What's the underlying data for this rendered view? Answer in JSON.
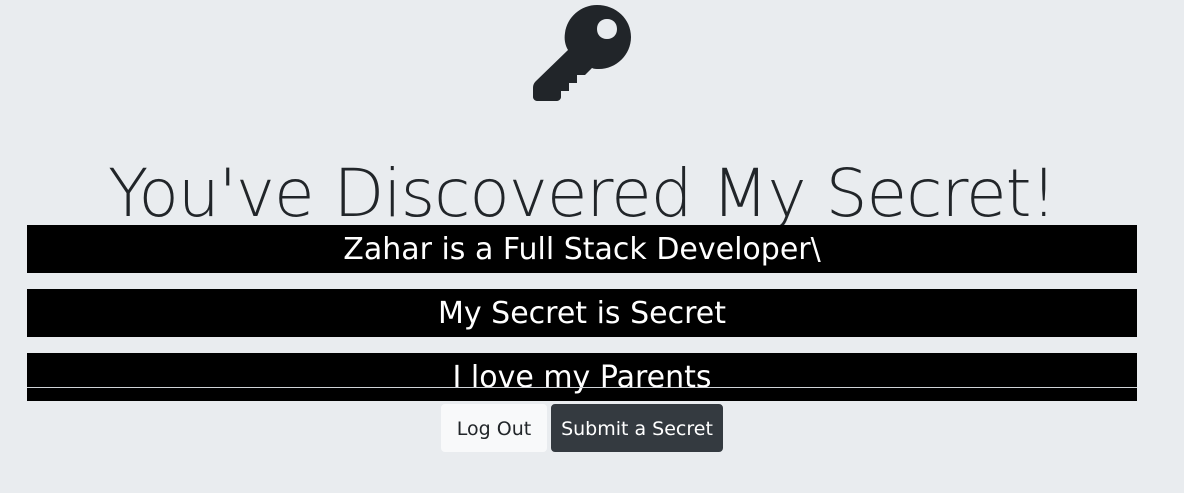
{
  "page": {
    "icon": "key-icon",
    "title": "You've Discovered My Secret!",
    "background_color": "#e9ecef"
  },
  "secrets": [
    {
      "text": "Zahar is a Full Stack Developer\\"
    },
    {
      "text": "My Secret is Secret"
    },
    {
      "text": "I love my Parents"
    }
  ],
  "actions": {
    "logout_label": "Log Out",
    "submit_label": "Submit a Secret",
    "submit_color": "#343a40",
    "logout_color": "#f8f9fa"
  }
}
